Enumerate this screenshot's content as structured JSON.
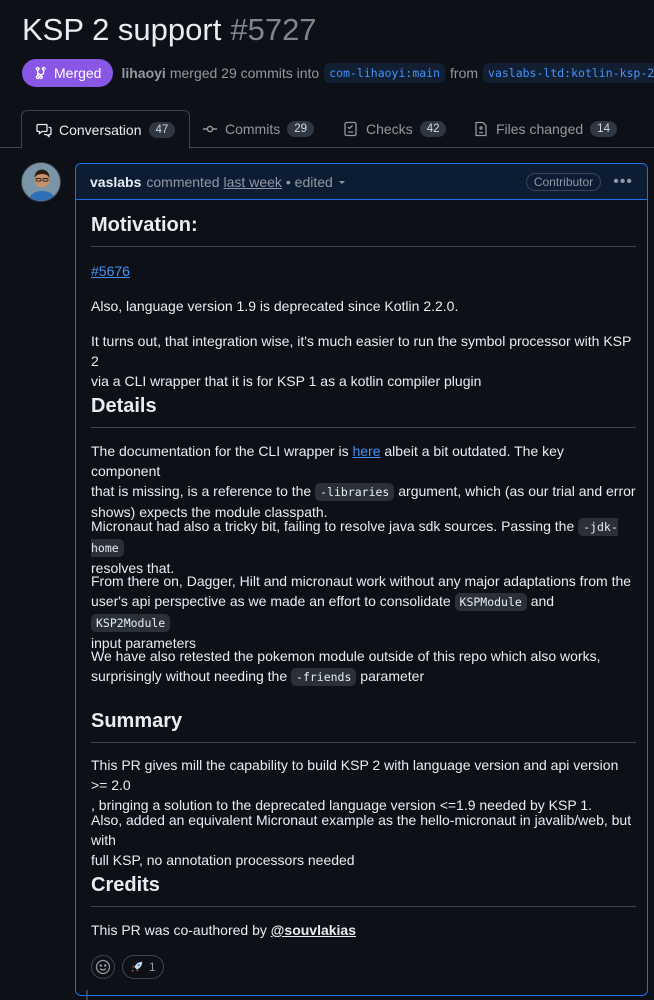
{
  "pr": {
    "title": "KSP 2 support",
    "number": "#5727",
    "state": "Merged",
    "author": "lihaoyi",
    "merge_text": "merged 29 commits into",
    "base_branch": "com-lihaoyi:main",
    "from_text": "from",
    "head_branch": "vaslabs-ltd:kotlin-ksp-2"
  },
  "tabs": [
    {
      "label": "Conversation",
      "count": "47",
      "icon": "comment-discussion-icon"
    },
    {
      "label": "Commits",
      "count": "29",
      "icon": "git-commit-icon"
    },
    {
      "label": "Checks",
      "count": "42",
      "icon": "checklist-icon"
    },
    {
      "label": "Files changed",
      "count": "14",
      "icon": "file-diff-icon"
    }
  ],
  "comment": {
    "author": "vaslabs",
    "action": "commented",
    "time": "last week",
    "edited": "• edited",
    "role": "Contributor",
    "menu": "•••",
    "h_motivation": "Motivation:",
    "issue_link": "#5676",
    "p_deprecated": "Also, language version 1.9 is deprecated since Kotlin 2.2.0.",
    "p_turns_out_1": "It turns out, that integration wise, it's much easier to run the symbol processor with KSP 2",
    "p_turns_out_2": "via a CLI wrapper that it is for KSP 1 as a kotlin compiler plugin",
    "h_details": "Details",
    "p_doc_1a": "The documentation for the CLI wrapper is ",
    "p_doc_link": "here",
    "p_doc_1b": " albeit a bit outdated. The key component",
    "p_doc_2a": "that is missing, is a reference to the ",
    "p_doc_code": "-libraries",
    "p_doc_2b": " argument, which (as our trial and error",
    "p_doc_3": "shows) expects the module classpath.",
    "p_micro_1a": "Micronaut had also a tricky bit, failing to resolve java sdk sources. Passing the ",
    "p_micro_code": "-jdk-home",
    "p_micro_2": "resolves that.",
    "p_dagger_1": "From there on, Dagger, Hilt and micronaut work without any major adaptations from the",
    "p_dagger_2a": "user's api perspective as we made an effort to consolidate ",
    "p_dagger_code1": "KSPModule",
    "p_dagger_and": " and ",
    "p_dagger_code2": "KSP2Module",
    "p_dagger_3": "input parameters",
    "p_poke_1": "We have also retested the pokemon module outside of this repo which also works,",
    "p_poke_2a": "surprisingly without needing the ",
    "p_poke_code": "-friends",
    "p_poke_2b": " parameter",
    "h_summary": "Summary",
    "p_sum_1": "This PR gives mill the capability to build KSP 2 with language version and api version >= 2.0",
    "p_sum_2": ", bringing a solution to the deprecated language version <=1.9 needed by KSP 1.",
    "p_also_1": "Also, added an equivalent Micronaut example as the hello-micronaut in javalib/web, but with",
    "p_also_2": "full KSP, no annotation processors needed",
    "h_credits": "Credits",
    "p_credit_a": "This PR was co-authored by ",
    "p_credit_mention": "@souvlakias",
    "reaction_rocket_count": "1"
  },
  "colors": {
    "merged": "#8957e5",
    "link": "#4493f8",
    "accent_border": "#1f6feb",
    "background": "#0d1117"
  }
}
